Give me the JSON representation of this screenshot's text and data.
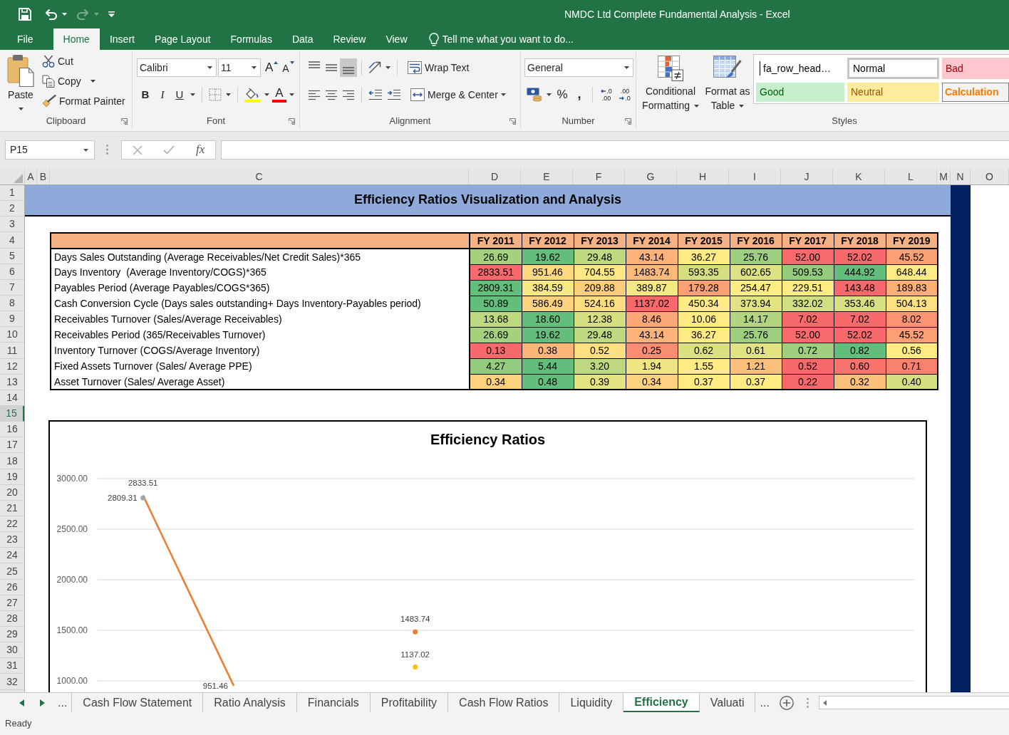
{
  "window": {
    "title": "NMDC Ltd Complete Fundamental Analysis - Excel"
  },
  "quick_access": [
    {
      "kind": "save",
      "disabled": false
    },
    {
      "kind": "undo",
      "disabled": false
    },
    {
      "kind": "redo",
      "disabled": true
    }
  ],
  "ribbon_tabs": [
    {
      "label": "File",
      "selected": false
    },
    {
      "label": "Home",
      "selected": true
    },
    {
      "label": "Insert",
      "selected": false
    },
    {
      "label": "Page Layout",
      "selected": false
    },
    {
      "label": "Formulas",
      "selected": false
    },
    {
      "label": "Data",
      "selected": false
    },
    {
      "label": "Review",
      "selected": false
    },
    {
      "label": "View",
      "selected": false
    }
  ],
  "tell_me": {
    "placeholder": "Tell me what you want to do..."
  },
  "clipboard": {
    "label": "Clipboard",
    "paste": "Paste",
    "cut": "Cut",
    "copy": "Copy",
    "format_painter": "Format Painter"
  },
  "font": {
    "label": "Font",
    "font_name": "Calibri",
    "font_size": "11",
    "size_buttons": [
      {
        "kind": "grow",
        "label": "A"
      },
      {
        "kind": "shrink",
        "label": "A"
      }
    ],
    "style_buttons": [
      {
        "kind": "bold",
        "label": "B"
      },
      {
        "kind": "italic",
        "label": "I"
      },
      {
        "kind": "underline",
        "label": "U"
      }
    ],
    "font_color_label": "A"
  },
  "alignment": {
    "label": "Alignment",
    "vertical": [
      {
        "kind": "top",
        "selected": false
      },
      {
        "kind": "middle",
        "selected": false
      },
      {
        "kind": "bottom",
        "selected": true
      }
    ],
    "wrap_text": "Wrap Text",
    "merge_center": "Merge & Center"
  },
  "number": {
    "label": "Number",
    "format": "General",
    "percent": "%",
    "comma": ",",
    "decimals": [
      {
        "kind": "increase",
        "top": ".0",
        "bottom": ".00"
      },
      {
        "kind": "decrease",
        "top": ".00",
        "bottom": ".0"
      }
    ]
  },
  "styles": {
    "label": "Styles",
    "conditional_formatting": "Conditional Formatting",
    "format_as_table": "Format as Table",
    "gallery": [
      {
        "kind": "custom",
        "label": "fa_row_head…"
      },
      {
        "kind": "normal",
        "label": "Normal"
      },
      {
        "kind": "bad",
        "label": "Bad"
      },
      {
        "kind": "good",
        "label": "Good"
      },
      {
        "kind": "neutral",
        "label": "Neutral"
      },
      {
        "kind": "calculation",
        "label": "Calculation"
      }
    ]
  },
  "formula_bar": {
    "name_box": "P15",
    "function_button": "fx"
  },
  "columns": [
    "A",
    "B",
    "C",
    "D",
    "E",
    "F",
    "G",
    "H",
    "I",
    "J",
    "K",
    "L",
    "M",
    "N",
    "O"
  ],
  "rows": [
    {
      "label": "1",
      "selected": false
    },
    {
      "label": "2",
      "selected": false
    },
    {
      "label": "3",
      "selected": false
    },
    {
      "label": "4",
      "selected": false
    },
    {
      "label": "5",
      "selected": false
    },
    {
      "label": "6",
      "selected": false
    },
    {
      "label": "7",
      "selected": false
    },
    {
      "label": "8",
      "selected": false
    },
    {
      "label": "9",
      "selected": false
    },
    {
      "label": "10",
      "selected": false
    },
    {
      "label": "11",
      "selected": false
    },
    {
      "label": "12",
      "selected": false
    },
    {
      "label": "13",
      "selected": false
    },
    {
      "label": "14",
      "selected": false
    },
    {
      "label": "15",
      "selected": true
    },
    {
      "label": "16",
      "selected": false
    },
    {
      "label": "17",
      "selected": false
    },
    {
      "label": "18",
      "selected": false
    },
    {
      "label": "19",
      "selected": false
    },
    {
      "label": "20",
      "selected": false
    },
    {
      "label": "21",
      "selected": false
    },
    {
      "label": "22",
      "selected": false
    },
    {
      "label": "23",
      "selected": false
    },
    {
      "label": "24",
      "selected": false
    },
    {
      "label": "25",
      "selected": false
    },
    {
      "label": "26",
      "selected": false
    },
    {
      "label": "27",
      "selected": false
    },
    {
      "label": "28",
      "selected": false
    },
    {
      "label": "29",
      "selected": false
    },
    {
      "label": "30",
      "selected": false
    },
    {
      "label": "31",
      "selected": false
    },
    {
      "label": "32",
      "selected": false
    }
  ],
  "sheet": {
    "title": "Efficiency Ratios Visualization and Analysis",
    "table": {
      "columns": [
        "FY 2011",
        "FY 2012",
        "FY 2013",
        "FY 2014",
        "FY 2015",
        "FY 2016",
        "FY 2017",
        "FY 2018",
        "FY 2019"
      ],
      "rows": [
        {
          "label": "Days Sales Outstanding (Average Receivables/Net Credit Sales)*365",
          "cells": [
            {
              "value": "26.69",
              "color": "#a5d17f"
            },
            {
              "value": "19.62",
              "color": "#63be7b"
            },
            {
              "value": "29.48",
              "color": "#bfd980"
            },
            {
              "value": "43.14",
              "color": "#fcb279"
            },
            {
              "value": "36.27",
              "color": "#ffeb84"
            },
            {
              "value": "25.76",
              "color": "#9dcf7e"
            },
            {
              "value": "52.00",
              "color": "#f86a6b"
            },
            {
              "value": "52.02",
              "color": "#f8696b"
            },
            {
              "value": "45.52",
              "color": "#fb9f75"
            }
          ]
        },
        {
          "label": "Days Inventory  (Average Inventory/COGS)*365",
          "cells": [
            {
              "value": "2833.51",
              "color": "#f8696b"
            },
            {
              "value": "951.46",
              "color": "#fed980"
            },
            {
              "value": "704.55",
              "color": "#ffe883"
            },
            {
              "value": "1483.74",
              "color": "#fcb97a"
            },
            {
              "value": "593.35",
              "color": "#d5df82"
            },
            {
              "value": "602.65",
              "color": "#dce182"
            },
            {
              "value": "509.53",
              "color": "#94cc7e"
            },
            {
              "value": "444.92",
              "color": "#63be7b"
            },
            {
              "value": "648.44",
              "color": "#ffeb84"
            }
          ]
        },
        {
          "label": "Payables Period (Average Payables/COGS*365)",
          "cells": [
            {
              "value": "2809.31",
              "color": "#63be7b"
            },
            {
              "value": "384.59",
              "color": "#f6e884"
            },
            {
              "value": "209.88",
              "color": "#fdcd7e"
            },
            {
              "value": "389.87",
              "color": "#f5e884"
            },
            {
              "value": "179.28",
              "color": "#fb9f75"
            },
            {
              "value": "254.47",
              "color": "#fdeb84"
            },
            {
              "value": "229.51",
              "color": "#ffeb84"
            },
            {
              "value": "143.48",
              "color": "#f8696b"
            },
            {
              "value": "189.83",
              "color": "#fcaf78"
            }
          ]
        },
        {
          "label": "Cash Conversion Cycle (Days sales outstanding+ Days Inventory-Payables period)",
          "cells": [
            {
              "value": "50.89",
              "color": "#63be7b"
            },
            {
              "value": "586.49",
              "color": "#fed17f"
            },
            {
              "value": "524.16",
              "color": "#fedd81"
            },
            {
              "value": "1137.02",
              "color": "#f8696b"
            },
            {
              "value": "450.34",
              "color": "#ffeb84"
            },
            {
              "value": "373.94",
              "color": "#e1e282"
            },
            {
              "value": "332.02",
              "color": "#d1de81"
            },
            {
              "value": "353.46",
              "color": "#d9e082"
            },
            {
              "value": "504.13",
              "color": "#fee182"
            }
          ]
        },
        {
          "label": "Receivables Turnover (Sales/Average Receivables)",
          "cells": [
            {
              "value": "13.68",
              "color": "#bdd880"
            },
            {
              "value": "18.60",
              "color": "#63be7b"
            },
            {
              "value": "12.38",
              "color": "#d5df82"
            },
            {
              "value": "8.46",
              "color": "#fba777"
            },
            {
              "value": "10.06",
              "color": "#ffeb84"
            },
            {
              "value": "14.17",
              "color": "#b4d580"
            },
            {
              "value": "7.02",
              "color": "#f8696b"
            },
            {
              "value": "7.02",
              "color": "#f8696b"
            },
            {
              "value": "8.02",
              "color": "#fa9473"
            }
          ]
        },
        {
          "label": "Receivables Period (365/Receivables Turnover)",
          "cells": [
            {
              "value": "26.69",
              "color": "#a5d17f"
            },
            {
              "value": "19.62",
              "color": "#63be7b"
            },
            {
              "value": "29.48",
              "color": "#bfd980"
            },
            {
              "value": "43.14",
              "color": "#fcb279"
            },
            {
              "value": "36.27",
              "color": "#ffeb84"
            },
            {
              "value": "25.76",
              "color": "#9dcf7e"
            },
            {
              "value": "52.00",
              "color": "#f86a6b"
            },
            {
              "value": "52.02",
              "color": "#f8696b"
            },
            {
              "value": "45.52",
              "color": "#fb9f75"
            }
          ]
        },
        {
          "label": "Inventory Turnover (COGS/Average Inventory)",
          "cells": [
            {
              "value": "0.13",
              "color": "#f8696b"
            },
            {
              "value": "0.38",
              "color": "#fcb579"
            },
            {
              "value": "0.52",
              "color": "#fedf82"
            },
            {
              "value": "0.25",
              "color": "#fa8d72"
            },
            {
              "value": "0.62",
              "color": "#dbe182"
            },
            {
              "value": "0.61",
              "color": "#e1e282"
            },
            {
              "value": "0.72",
              "color": "#9fcf7e"
            },
            {
              "value": "0.82",
              "color": "#63be7b"
            },
            {
              "value": "0.56",
              "color": "#ffeb84"
            }
          ]
        },
        {
          "label": "Fixed Assets Turnover (Sales/ Average PPE)",
          "cells": [
            {
              "value": "4.27",
              "color": "#92cc7e"
            },
            {
              "value": "5.44",
              "color": "#63be7b"
            },
            {
              "value": "3.20",
              "color": "#bdd880"
            },
            {
              "value": "1.94",
              "color": "#efe683"
            },
            {
              "value": "1.55",
              "color": "#ffeb84"
            },
            {
              "value": "1.21",
              "color": "#fdc07c"
            },
            {
              "value": "0.52",
              "color": "#f8696b"
            },
            {
              "value": "0.60",
              "color": "#f9736d"
            },
            {
              "value": "0.71",
              "color": "#f98170"
            }
          ]
        },
        {
          "label": "Asset Turnover (Sales/ Average Asset)",
          "cells": [
            {
              "value": "0.34",
              "color": "#fed17f"
            },
            {
              "value": "0.48",
              "color": "#63be7b"
            },
            {
              "value": "0.39",
              "color": "#e3e382"
            },
            {
              "value": "0.34",
              "color": "#fed17f"
            },
            {
              "value": "0.37",
              "color": "#ffeb84"
            },
            {
              "value": "0.37",
              "color": "#ffeb84"
            },
            {
              "value": "0.22",
              "color": "#f8696b"
            },
            {
              "value": "0.32",
              "color": "#fdc07c"
            },
            {
              "value": "0.40",
              "color": "#d4df82"
            }
          ]
        }
      ]
    },
    "chart": {
      "title": "Efficiency Ratios",
      "chart_data": {
        "type": "line",
        "ylim": [
          890,
          3000
        ],
        "yticks": [
          {
            "value": 1000,
            "label": "1000.00"
          },
          {
            "value": 1500,
            "label": "1500.00"
          },
          {
            "value": 2000,
            "label": "2000.00"
          },
          {
            "value": 2500,
            "label": "2500.00"
          },
          {
            "value": 3000,
            "label": "3000.00"
          }
        ],
        "grid": true,
        "series": [
          {
            "color": "#ed7d31",
            "marker": true,
            "values": [
              2833.51,
              951.46,
              null,
              1483.74,
              null,
              null,
              null,
              null,
              null
            ],
            "value_labels": [
              "2833.51",
              "951.46",
              null,
              "1483.74",
              null,
              null,
              null,
              null,
              null
            ]
          },
          {
            "color": "#a5a5a5",
            "marker": true,
            "values": [
              2809.31,
              null,
              null,
              null,
              null,
              null,
              null,
              null,
              null
            ],
            "value_labels": [
              "2809.31",
              null,
              null,
              null,
              null,
              null,
              null,
              null,
              null
            ]
          },
          {
            "color": "#ffc000",
            "marker": true,
            "values": [
              null,
              null,
              null,
              1137.02,
              null,
              null,
              null,
              null,
              null
            ],
            "value_labels": [
              null,
              null,
              null,
              "1137.02",
              null,
              null,
              null,
              null,
              null
            ]
          }
        ]
      }
    }
  },
  "sheet_tabs": [
    {
      "label": "Cash Flow Statement",
      "selected": false
    },
    {
      "label": "Ratio Analysis",
      "selected": false
    },
    {
      "label": "Financials",
      "selected": false
    },
    {
      "label": "Profitability",
      "selected": false
    },
    {
      "label": "Cash Flow Ratios",
      "selected": false
    },
    {
      "label": "Liquidity",
      "selected": false
    },
    {
      "label": "Efficiency",
      "selected": true
    },
    {
      "label": "Valuati",
      "selected": false
    }
  ],
  "tab_overflow": {
    "left": "...",
    "right": "..."
  },
  "status_bar": {
    "text": "Ready"
  }
}
